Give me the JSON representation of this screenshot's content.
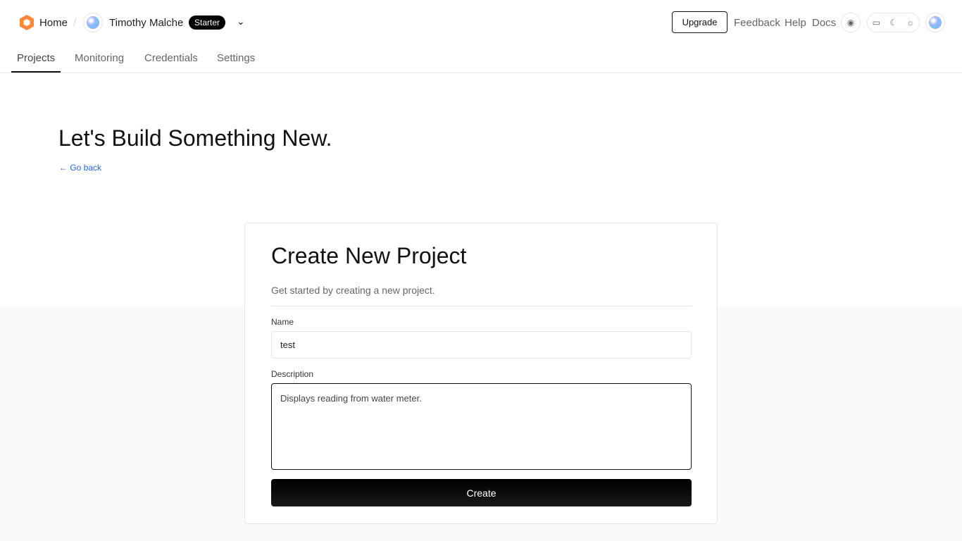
{
  "header": {
    "home": "Home",
    "user": "Timothy Malche",
    "plan": "Starter",
    "upgrade": "Upgrade",
    "links": [
      "Feedback",
      "Help",
      "Docs"
    ]
  },
  "tabs": [
    "Projects",
    "Monitoring",
    "Credentials",
    "Settings"
  ],
  "page": {
    "title": "Let's Build Something New.",
    "back": "Go back"
  },
  "form": {
    "title": "Create New Project",
    "subtitle": "Get started by creating a new project.",
    "name_label": "Name",
    "name_value": "test",
    "description_label": "Description",
    "description_value": "Displays reading from water meter.",
    "submit": "Create"
  }
}
